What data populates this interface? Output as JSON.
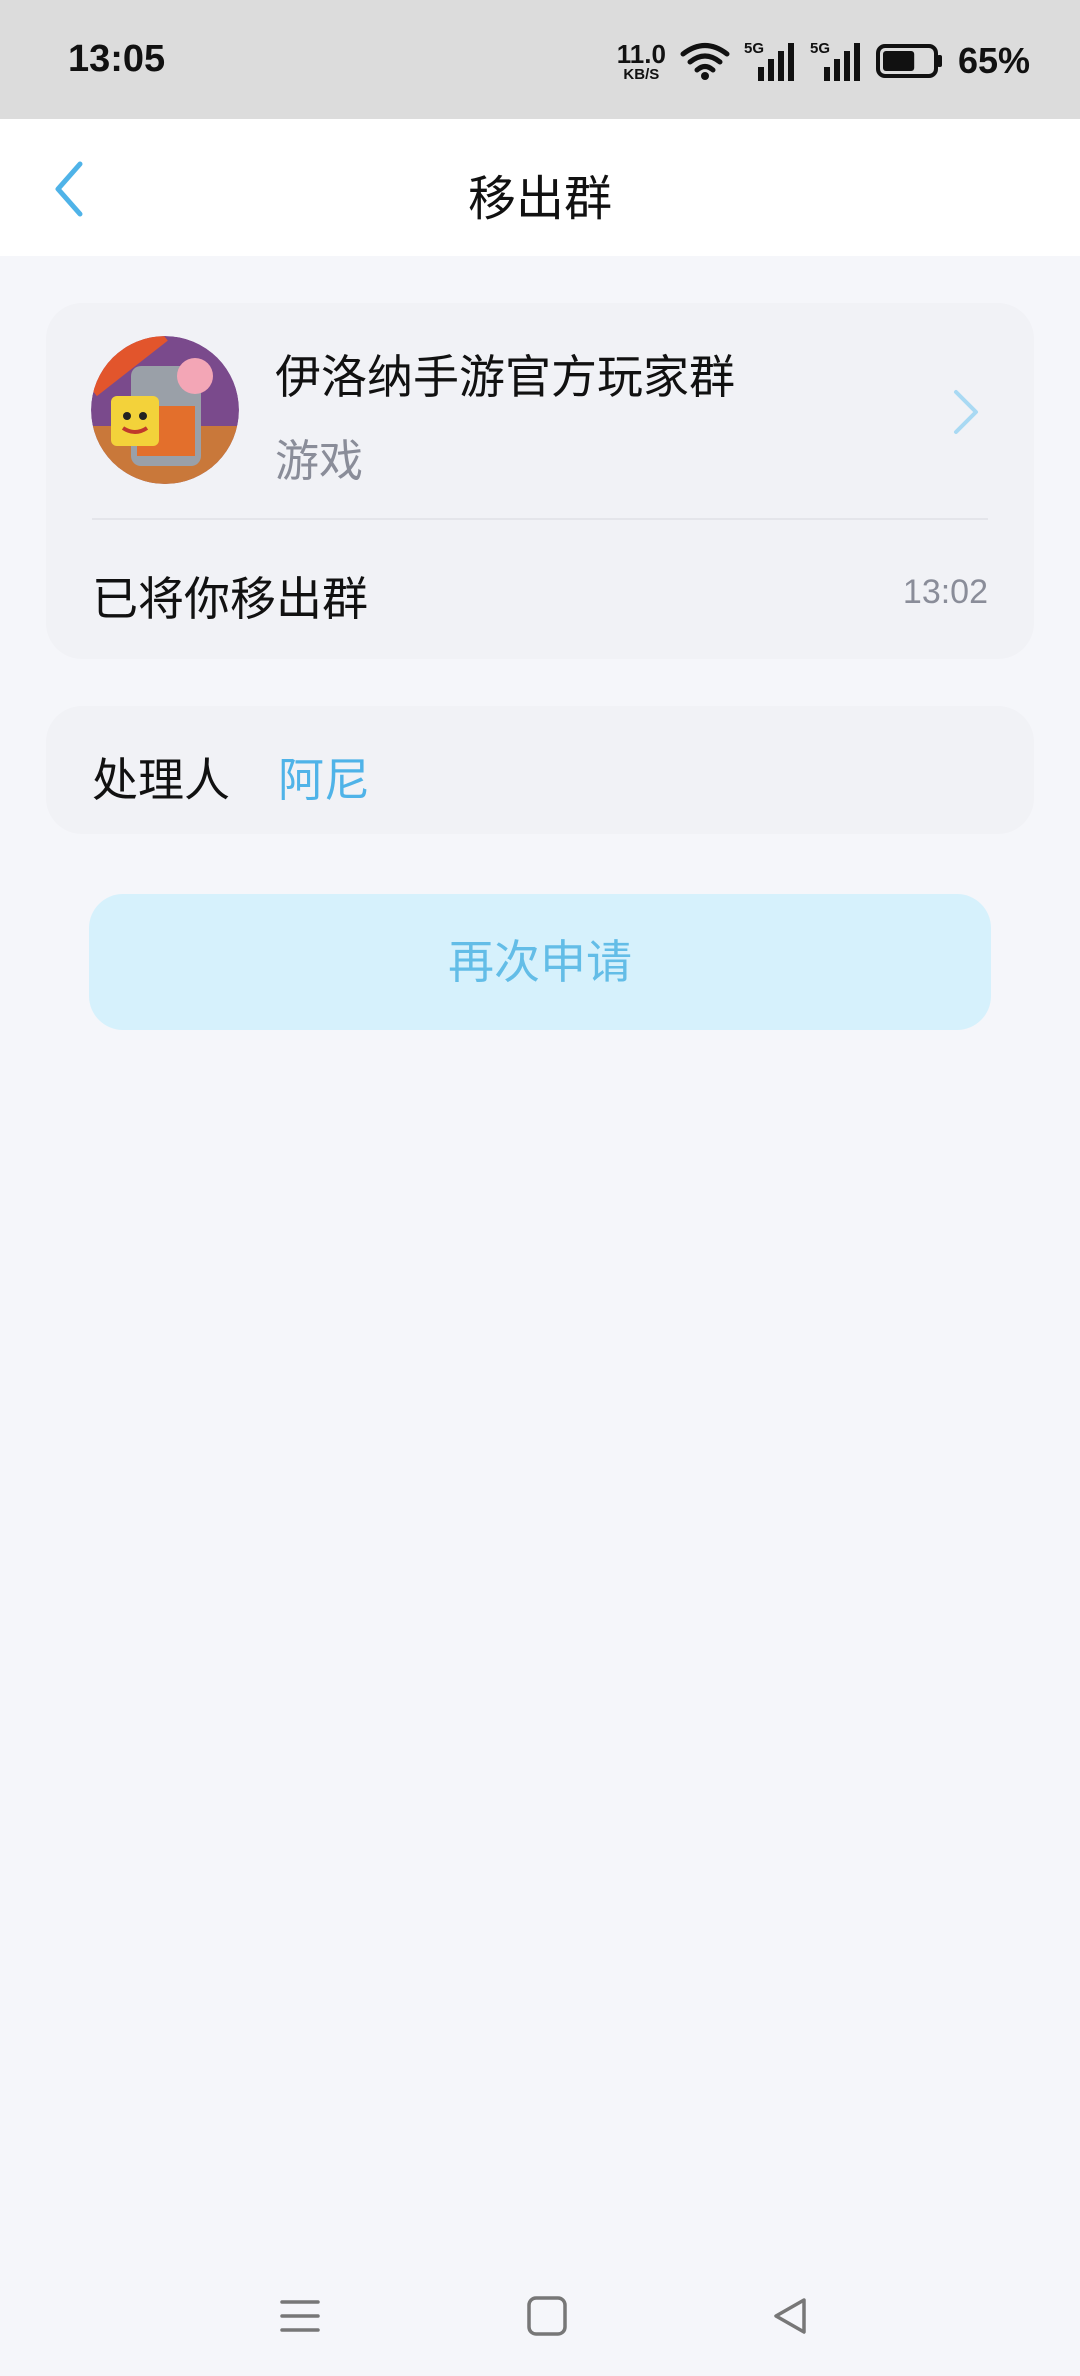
{
  "status_bar": {
    "time": "13:05",
    "net_speed_value": "11.0",
    "net_speed_unit": "KB/S",
    "signal_1": "5G",
    "signal_2": "5G",
    "battery_percent": "65%",
    "battery_level": 0.65
  },
  "nav": {
    "title": "移出群",
    "back_icon": "chevron-left-icon"
  },
  "group": {
    "name": "伊洛纳手游官方玩家群",
    "category": "游戏",
    "status_message": "已将你移出群",
    "time": "13:02"
  },
  "handler": {
    "label": "处理人",
    "name": "阿尼"
  },
  "actions": {
    "reapply_label": "再次申请"
  },
  "colors": {
    "accent": "#4fb3e8",
    "button_bg": "#d6f1fc",
    "page_bg": "#f5f6fa",
    "card_bg": "#f1f2f6"
  }
}
